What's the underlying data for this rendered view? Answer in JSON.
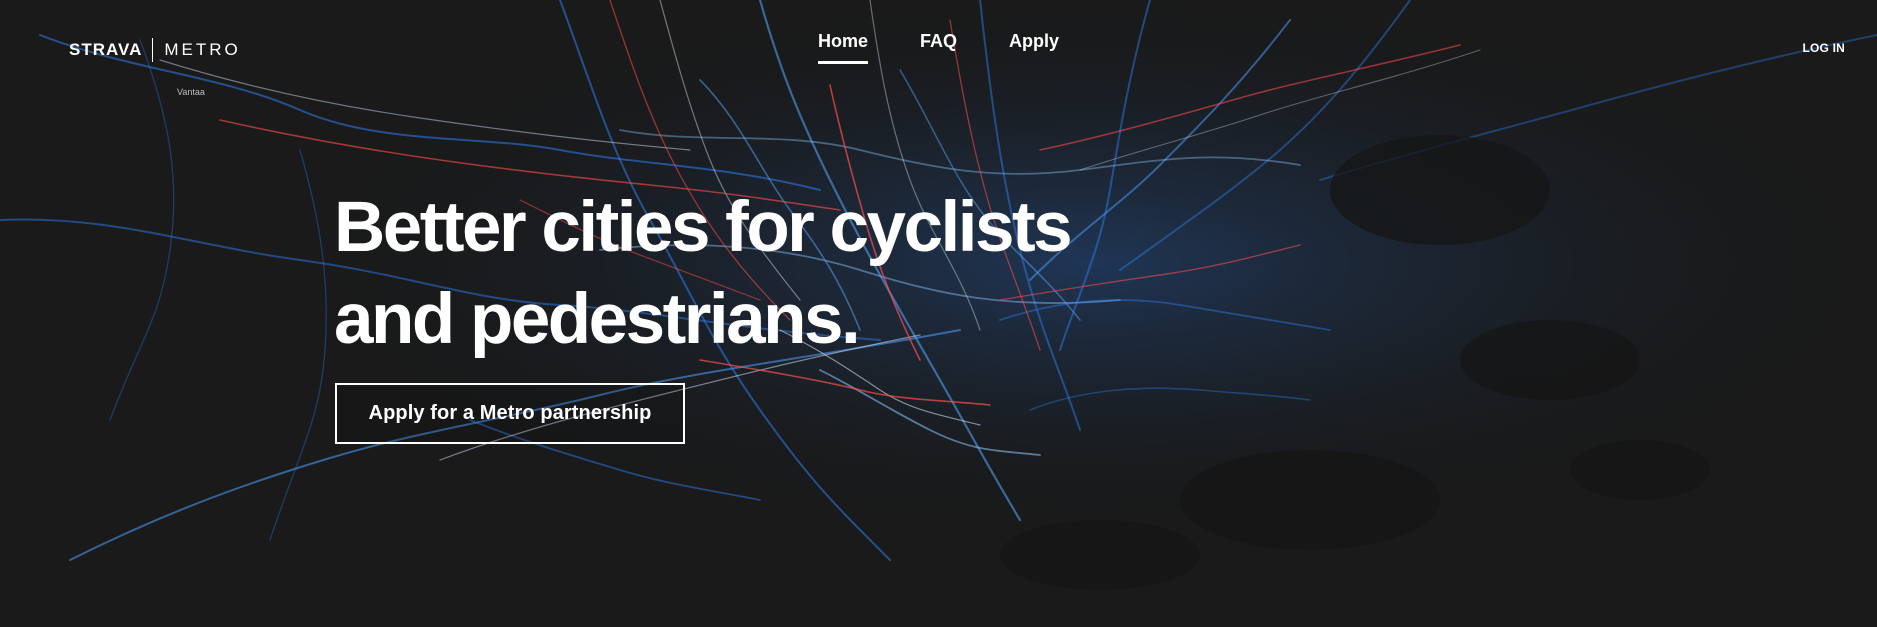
{
  "brand": {
    "name": "STRAVA",
    "product": "METRO"
  },
  "nav": {
    "items": [
      {
        "label": "Home",
        "active": true
      },
      {
        "label": "FAQ",
        "active": false
      },
      {
        "label": "Apply",
        "active": false
      }
    ],
    "login_label": "LOG IN"
  },
  "hero": {
    "headline_line1": "Better cities for cyclists",
    "headline_line2": "and pedestrians.",
    "cta_label": "Apply for a Metro partnership",
    "map_place_label": "Vantaa"
  },
  "colors": {
    "background": "#1a1a1a",
    "heat_blue": "#2f86ff",
    "heat_light": "#a8d2ff",
    "heat_red": "#ff4d4d",
    "text": "#ffffff"
  },
  "icons": {
    "background_visual": "route-heatmap"
  }
}
